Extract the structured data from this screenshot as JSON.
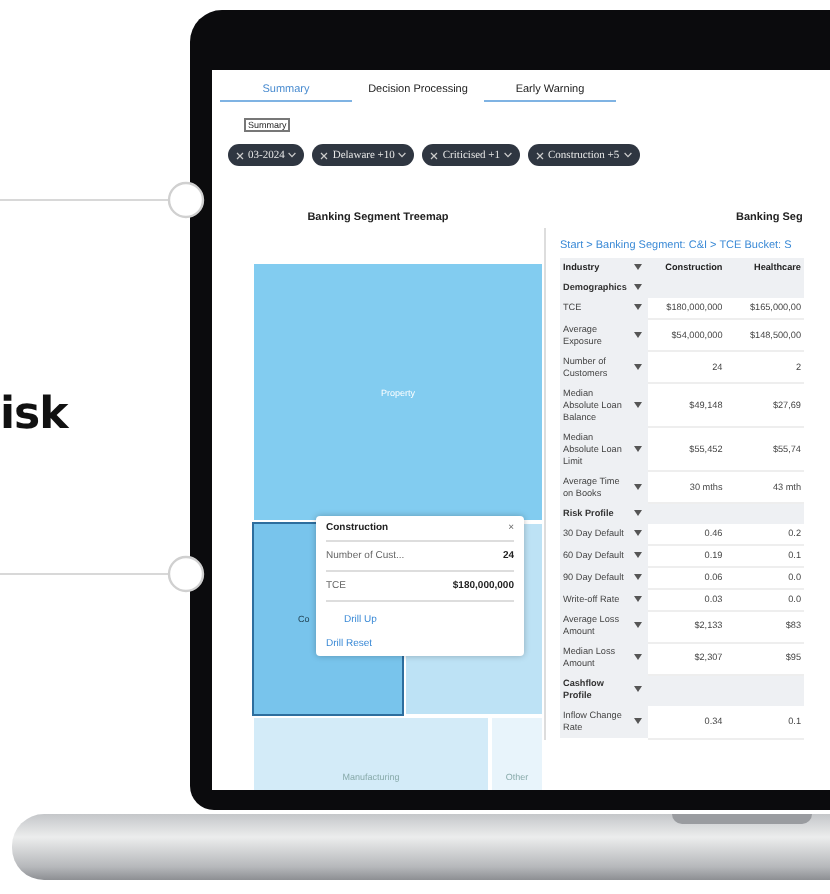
{
  "side_text": "isk",
  "tabs": [
    {
      "label": "Summary",
      "selected": true,
      "underlined": true
    },
    {
      "label": "Decision Processing",
      "selected": false,
      "underlined": false
    },
    {
      "label": "Early Warning",
      "selected": false,
      "underlined": true
    }
  ],
  "tooltip": "Summary",
  "filters": [
    {
      "label": "03-2024"
    },
    {
      "label": "Delaware +10"
    },
    {
      "label": "Criticised +1"
    },
    {
      "label": "Construction +5"
    }
  ],
  "treemap": {
    "title": "Banking Segment Treemap",
    "blocks": [
      {
        "label": "Property",
        "selected": false,
        "color": "#82ccf0"
      },
      {
        "label": "Co",
        "selected": true,
        "color": "#78c4ec"
      },
      {
        "selected": false,
        "color": "#bde2f5"
      },
      {
        "label": "Manufacturing",
        "selected": false,
        "color": "#d3ebf8"
      },
      {
        "label": "Other",
        "selected": false,
        "color": "#e8f4fb"
      }
    ],
    "popup": {
      "title": "Construction",
      "close": "×",
      "rows": [
        {
          "label": "Number of Cust...",
          "value": "24"
        },
        {
          "label": "TCE",
          "value": "$180,000,000"
        }
      ],
      "links": [
        "Drill Up",
        "Drill Reset"
      ]
    }
  },
  "table_panel": {
    "title": "Banking Seg",
    "breadcrumb": "Start > Banking Segment: C&I > TCE Bucket: S",
    "columns": [
      "Industry",
      "Construction",
      "Healthcare"
    ],
    "rows": [
      {
        "kind": "section",
        "label": "Demographics"
      },
      {
        "kind": "metric",
        "label": "TCE",
        "values": [
          "$180,000,000",
          "$165,000,00"
        ]
      },
      {
        "kind": "metric",
        "label": "Average Exposure",
        "values": [
          "$54,000,000",
          "$148,500,00"
        ]
      },
      {
        "kind": "metric",
        "label": "Number of Customers",
        "values": [
          "24",
          "2"
        ]
      },
      {
        "kind": "metric",
        "label": "Median Absolute Loan Balance",
        "values": [
          "$49,148",
          "$27,69"
        ]
      },
      {
        "kind": "metric",
        "label": "Median Absolute Loan Limit",
        "values": [
          "$55,452",
          "$55,74"
        ]
      },
      {
        "kind": "metric",
        "label": "Average Time on Books",
        "values": [
          "30 mths",
          "43 mth"
        ]
      },
      {
        "kind": "section",
        "label": "Risk Profile"
      },
      {
        "kind": "metric",
        "label": "30 Day Default",
        "values": [
          "0.46",
          "0.2"
        ]
      },
      {
        "kind": "metric",
        "label": "60 Day Default",
        "values": [
          "0.19",
          "0.1"
        ]
      },
      {
        "kind": "metric",
        "label": "90 Day Default",
        "values": [
          "0.06",
          "0.0"
        ]
      },
      {
        "kind": "metric",
        "label": "Write-off Rate",
        "values": [
          "0.03",
          "0.0"
        ]
      },
      {
        "kind": "metric",
        "label": "Average Loss Amount",
        "values": [
          "$2,133",
          "$83"
        ]
      },
      {
        "kind": "metric",
        "label": "Median Loss Amount",
        "values": [
          "$2,307",
          "$95"
        ]
      },
      {
        "kind": "section",
        "label": "Cashflow Profile"
      },
      {
        "kind": "metric",
        "label": "Inflow Change Rate",
        "values": [
          "0.34",
          "0.1"
        ]
      }
    ]
  }
}
